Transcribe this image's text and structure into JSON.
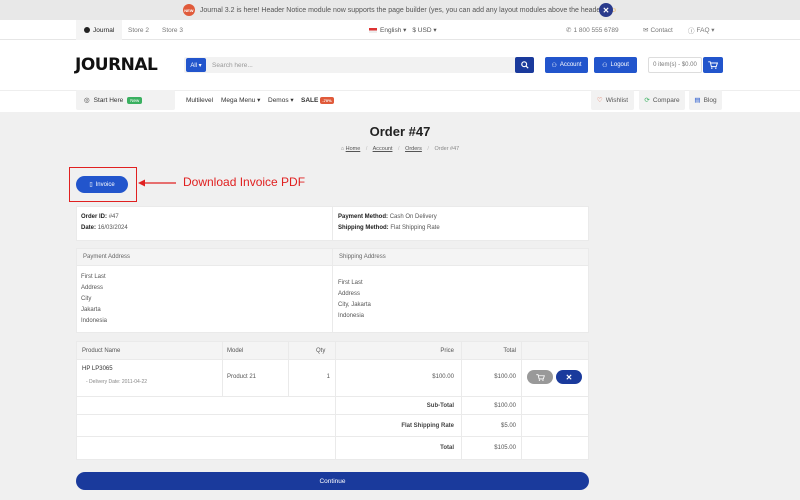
{
  "notice": {
    "badge": "NEW",
    "text": "Journal 3.2 is here! Header Notice module now supports the page builder (yes, you can add any layout modules above the header )",
    "close": "✕"
  },
  "stores": [
    "Journal",
    "Store 2",
    "Store 3"
  ],
  "locale": {
    "language": "English ▾",
    "currency": "$ USD ▾"
  },
  "top_links": {
    "phone": "1 800 555 6789",
    "contact": "Contact",
    "faq": "FAQ ▾"
  },
  "header": {
    "logo": "JOURNAL",
    "search_category": "All ▾",
    "search_placeholder": "Search here...",
    "account": "Account",
    "logout": "Logout",
    "cart": "0 item(s) - $0.00"
  },
  "nav": {
    "start_here": "Start Here",
    "start_badge": "New",
    "items": [
      "Multilevel",
      "Mega Menu ▾",
      "Demos ▾",
      "SALE"
    ],
    "sale_badge": "-70%",
    "wishlist": "Wishlist",
    "compare": "Compare",
    "blog": "Blog"
  },
  "page": {
    "title": "Order #47",
    "breadcrumb": [
      "Home",
      "Account",
      "Orders",
      "Order #47"
    ]
  },
  "invoice_button": "Invoice",
  "annotation": {
    "text": "Download Invoice PDF",
    "color": "#e02020"
  },
  "order_info": {
    "order_id_label": "Order ID:",
    "order_id": "#47",
    "date_label": "Date:",
    "date": "16/03/2024",
    "payment_label": "Payment Method:",
    "payment": "Cash On Delivery",
    "shipping_label": "Shipping Method:",
    "shipping": "Flat Shipping Rate"
  },
  "addresses": {
    "payment_header": "Payment Address",
    "shipping_header": "Shipping Address",
    "payment_lines": [
      "First Last",
      "Address",
      "City",
      "Jakarta",
      "Indonesia"
    ],
    "shipping_lines": [
      "First Last",
      "Address",
      "City, Jakarta",
      "Indonesia"
    ]
  },
  "products": {
    "headers": [
      "Product Name",
      "Model",
      "Qty",
      "Price",
      "Total"
    ],
    "rows": [
      {
        "name": "HP LP3065",
        "option": "- Delivery Date: 2011-04-22",
        "model": "Product 21",
        "qty": "1",
        "price": "$100.00",
        "total": "$100.00"
      }
    ],
    "totals": [
      {
        "label": "Sub-Total",
        "value": "$100.00"
      },
      {
        "label": "Flat Shipping Rate",
        "value": "$5.00"
      },
      {
        "label": "Total",
        "value": "$105.00"
      }
    ]
  },
  "continue_button": "Continue",
  "colors": {
    "primary": "#2255cc",
    "dark_primary": "#1a3a9c",
    "accent": "#e05a3a",
    "annotation": "#e02020"
  }
}
